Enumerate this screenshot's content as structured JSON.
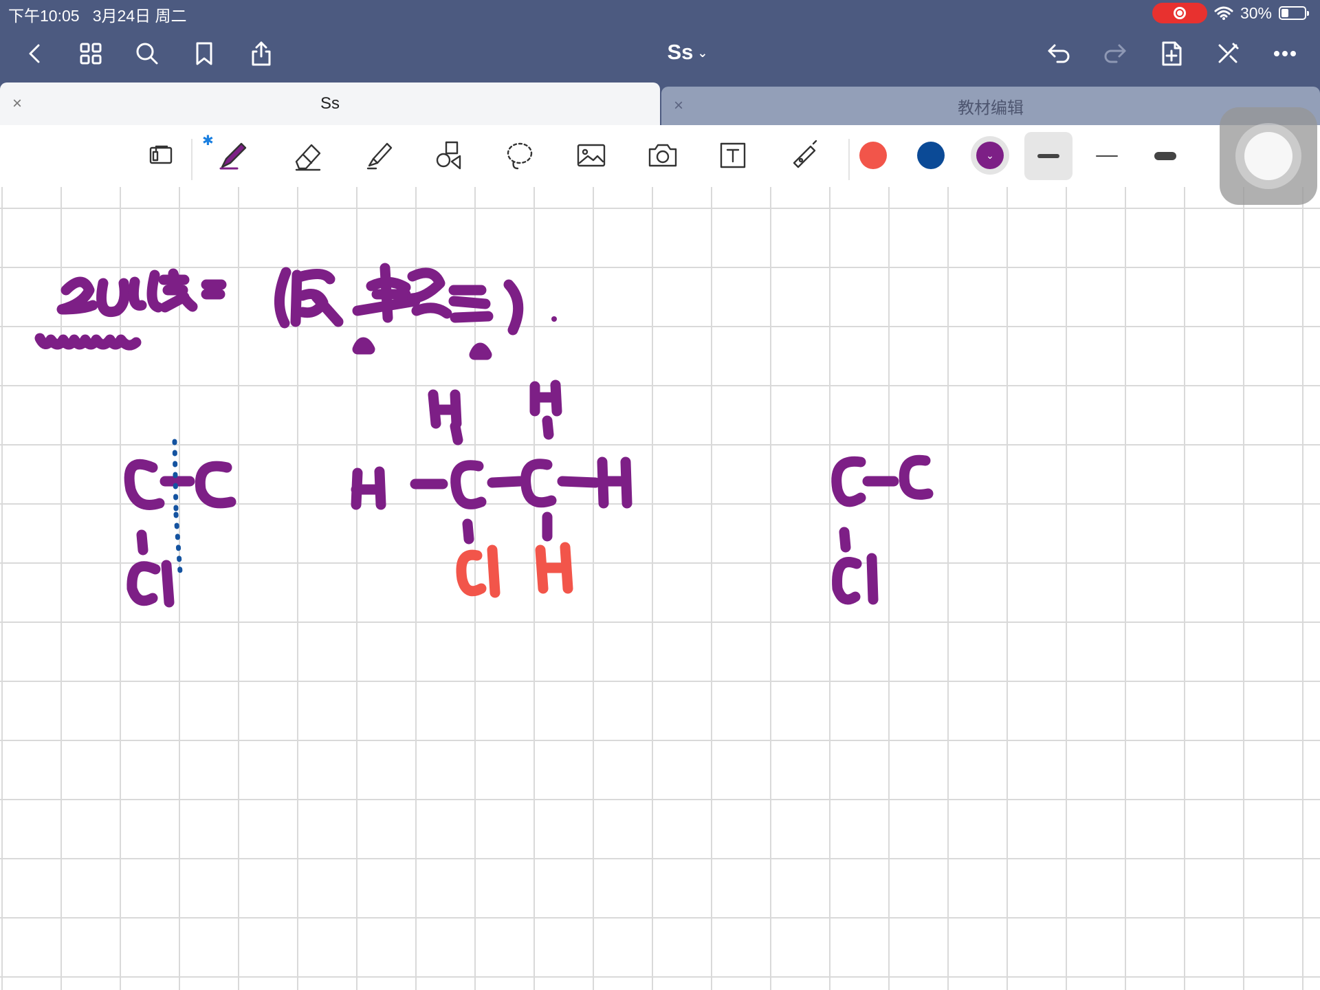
{
  "status_bar": {
    "time": "下午10:05",
    "date": "3月24日 周二",
    "battery": "30%"
  },
  "nav": {
    "title": "Ss",
    "left_icons": [
      "back-icon",
      "grid-icon",
      "search-icon",
      "bookmark-icon",
      "share-icon"
    ],
    "right_icons": [
      "undo-icon",
      "redo-icon",
      "add-page-icon",
      "close-toolbar-icon",
      "more-icon"
    ]
  },
  "tabs": [
    {
      "label": "Ss",
      "active": true
    },
    {
      "label": "教材编辑",
      "active": false
    }
  ],
  "toolbar": {
    "tools": [
      "page-layout-icon",
      "pen-icon",
      "eraser-icon",
      "highlighter-icon",
      "shapes-icon",
      "lasso-icon",
      "image-icon",
      "camera-icon",
      "text-box-icon",
      "laser-pointer-icon"
    ],
    "colors": [
      "#f2554a",
      "#0b4a96",
      "#7d1f86"
    ],
    "selected_color": "#7d1f86",
    "stroke_widths": [
      "medium",
      "thin",
      "thick"
    ],
    "selected_stroke": "medium"
  },
  "canvas": {
    "background": "grid",
    "ink_colors": {
      "purple": "#7d1f86",
      "red": "#f2554a",
      "blue": "#1453a0"
    }
  }
}
